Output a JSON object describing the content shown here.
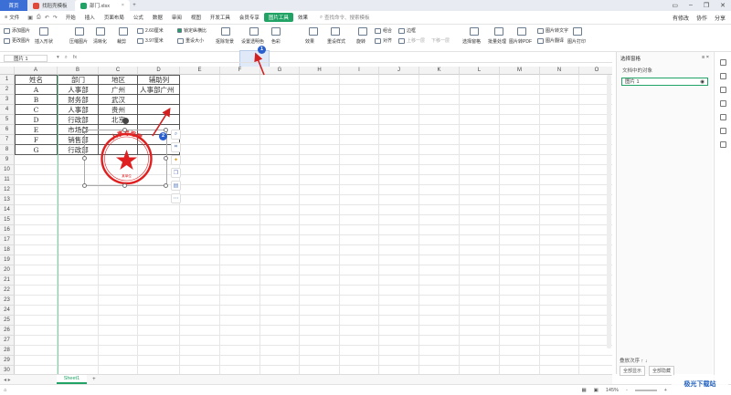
{
  "titlebar": {
    "tab_home": "首页",
    "tab_template": "找稻壳模板",
    "tab_file": "部门.xlsx"
  },
  "menubar": {
    "file": "文件",
    "items": [
      "开始",
      "插入",
      "页面布局",
      "公式",
      "数据",
      "审阅",
      "视图",
      "开发工具",
      "会员专享",
      "图片工具",
      "效果"
    ],
    "active_index": 9,
    "search": "查找命令、搜索模板",
    "right": [
      "有修改",
      "协作",
      "分享"
    ]
  },
  "ribbon": {
    "add_image": "添加图片",
    "change_image": "更改图片",
    "insert_shape": "插入形状",
    "compress": "压缩图片",
    "sharpen": "清晰化",
    "crop": "裁剪",
    "width": "2.60厘米",
    "height": "3.97厘米",
    "lock_ratio": "锁定纵横比",
    "reset_size": "重设大小",
    "remove_bg": "抠除背景",
    "set_transparent": "设置透明色",
    "color": "色彩",
    "effects": "效果",
    "reset_style": "重设样式",
    "rotate": "旋转",
    "combine": "组合",
    "align": "对齐",
    "border": "边框",
    "up_one": "上移一层",
    "down_one": "下移一层",
    "select_pane": "选择窗格",
    "batch": "批量处理",
    "to_pdf": "图片转PDF",
    "to_text": "图片转文字",
    "translate": "图片翻译",
    "print": "图片打印"
  },
  "formula_bar": {
    "name_box": "图片 1",
    "fx": "fx"
  },
  "columns": [
    "A",
    "B",
    "C",
    "D",
    "E",
    "F",
    "G",
    "H",
    "I",
    "J",
    "K",
    "L",
    "M",
    "N",
    "O"
  ],
  "rows": [
    "1",
    "2",
    "3",
    "4",
    "5",
    "6",
    "7",
    "8",
    "9",
    "10",
    "11",
    "12",
    "13",
    "14",
    "15",
    "16",
    "17",
    "18",
    "19",
    "20",
    "21",
    "22",
    "23",
    "24",
    "25",
    "26",
    "27",
    "28",
    "29",
    "30"
  ],
  "table": {
    "header": [
      "姓名",
      "部门",
      "地区",
      "辅助列"
    ],
    "rows": [
      [
        "A",
        "人事部",
        "广州",
        "人事部广州"
      ],
      [
        "B",
        "财务部",
        "武汉",
        ""
      ],
      [
        "C",
        "人事部",
        "贵州",
        ""
      ],
      [
        "D",
        "行政部",
        "北京",
        ""
      ],
      [
        "E",
        "市场部",
        "",
        ""
      ],
      [
        "F",
        "销售部",
        "",
        ""
      ],
      [
        "G",
        "行政部",
        "",
        ""
      ]
    ]
  },
  "stamp": {
    "text": "人事专用章",
    "sub": "某单位",
    "color": "#e02020"
  },
  "annotations": {
    "badge1": "1",
    "badge2": "2",
    "arrow_color": "#d21f1f"
  },
  "sheetbar": {
    "sheet": "Sheet1",
    "add": "+"
  },
  "status": {
    "zoom": "145%",
    "minus": "-",
    "plus": "+"
  },
  "panel": {
    "title": "选择窗格",
    "subtitle": "文档中的对象",
    "item": "图片 1",
    "foot_label": "叠放次序",
    "show_all": "全部显示",
    "hide_all": "全部隐藏"
  },
  "watermark": "极光下载站",
  "accent": "#21a366"
}
